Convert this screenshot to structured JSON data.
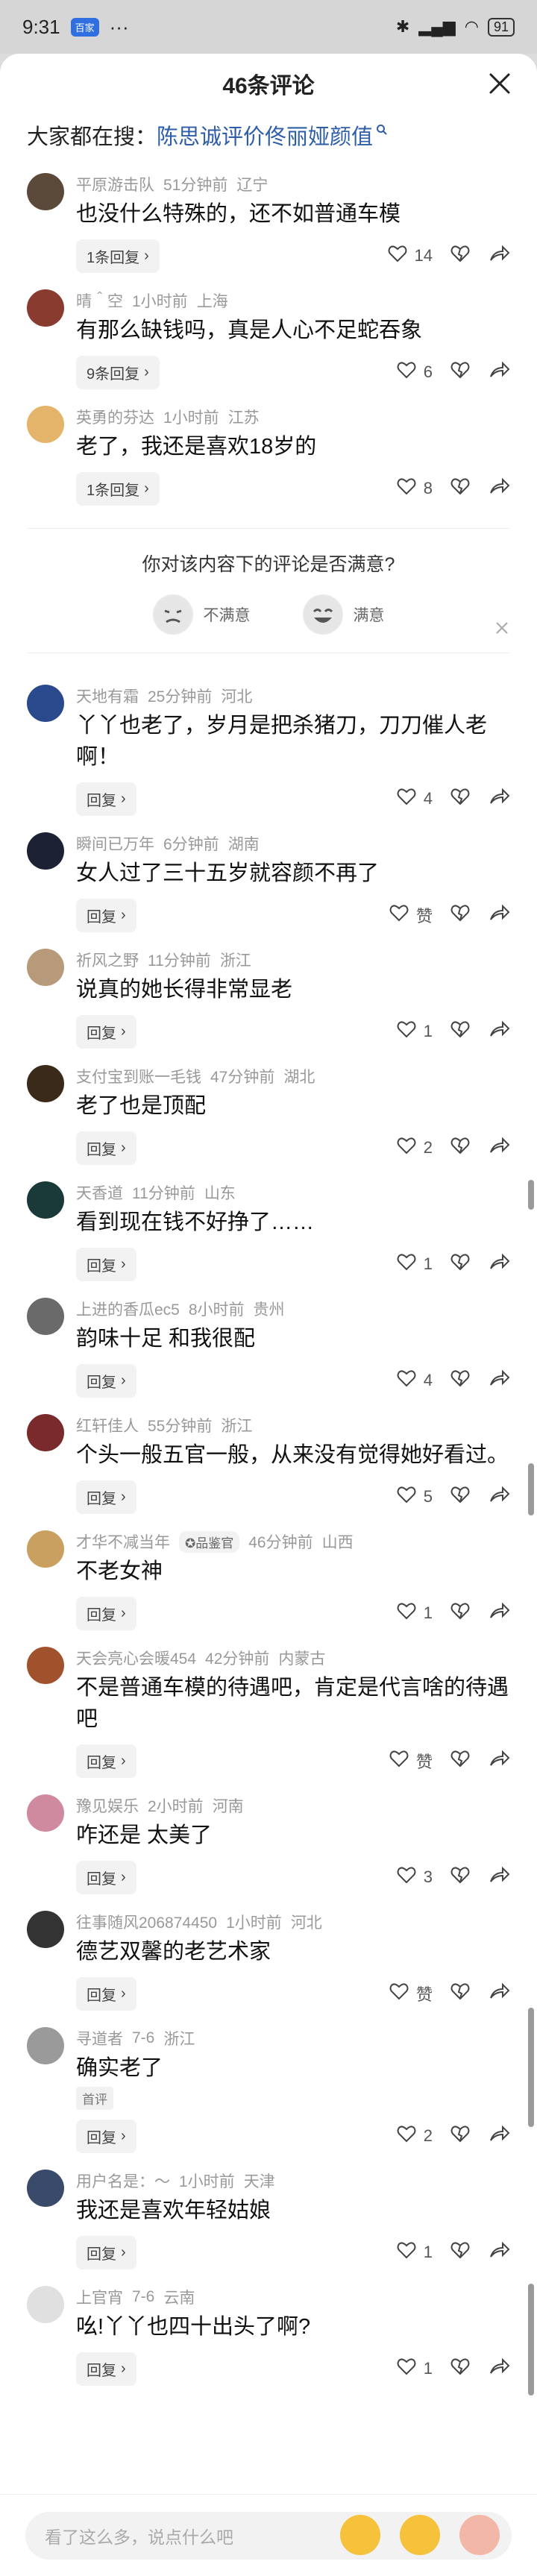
{
  "status": {
    "time": "9:31",
    "app_badge": "百家",
    "dots": "···",
    "battery": "91"
  },
  "header": {
    "title": "46条评论"
  },
  "search": {
    "prefix": "大家都在搜：",
    "query": "陈思诚评价佟丽娅颜值"
  },
  "survey": {
    "question": "你对该内容下的评论是否满意?",
    "opt_bad": "不满意",
    "opt_good": "满意"
  },
  "input": {
    "placeholder": "看了这么多，说点什么吧"
  },
  "comments": [
    {
      "user": "平原游击队",
      "time": "51分钟前",
      "loc": "辽宁",
      "text": "也没什么特殊的，还不如普通车模",
      "reply": "1条回复",
      "like": "14"
    },
    {
      "user": "晴＾空",
      "time": "1小时前",
      "loc": "上海",
      "text": "有那么缺钱吗，真是人心不足蛇吞象",
      "reply": "9条回复",
      "like": "6"
    },
    {
      "user": "英勇的芬达",
      "time": "1小时前",
      "loc": "江苏",
      "text": "老了，我还是喜欢18岁的",
      "reply": "1条回复",
      "like": "8"
    },
    {
      "user": "天地有霜",
      "time": "25分钟前",
      "loc": "河北",
      "text": "丫丫也老了，岁月是把杀猪刀，刀刀催人老啊！",
      "reply": "回复",
      "like": "4"
    },
    {
      "user": "瞬间已万年",
      "time": "6分钟前",
      "loc": "湖南",
      "text": "女人过了三十五岁就容颜不再了",
      "reply": "回复",
      "like": "赞"
    },
    {
      "user": "祈风之野",
      "time": "11分钟前",
      "loc": "浙江",
      "text": "说真的她长得非常显老",
      "reply": "回复",
      "like": "1"
    },
    {
      "user": "支付宝到账一毛钱",
      "time": "47分钟前",
      "loc": "湖北",
      "text": "老了也是顶配",
      "reply": "回复",
      "like": "2"
    },
    {
      "user": "天香道",
      "time": "11分钟前",
      "loc": "山东",
      "text": "看到现在钱不好挣了……",
      "reply": "回复",
      "like": "1"
    },
    {
      "user": "上进的香瓜ec5",
      "time": "8小时前",
      "loc": "贵州",
      "text": "韵味十足 和我很配",
      "reply": "回复",
      "like": "4"
    },
    {
      "user": "红轩佳人",
      "time": "55分钟前",
      "loc": "浙江",
      "text": "个头一般五官一般，从来没有觉得她好看过。",
      "reply": "回复",
      "like": "5"
    },
    {
      "user": "才华不减当年",
      "badge": "品鉴官",
      "time": "46分钟前",
      "loc": "山西",
      "text": "不老女神",
      "reply": "回复",
      "like": "1"
    },
    {
      "user": "天会亮心会暖454",
      "time": "42分钟前",
      "loc": "内蒙古",
      "text": "不是普通车模的待遇吧，肯定是代言啥的待遇吧",
      "reply": "回复",
      "like": "赞"
    },
    {
      "user": "豫见娱乐",
      "time": "2小时前",
      "loc": "河南",
      "text": "咋还是 太美了",
      "reply": "回复",
      "like": "3"
    },
    {
      "user": "往事随风206874450",
      "time": "1小时前",
      "loc": "河北",
      "text": "德艺双馨的老艺术家",
      "reply": "回复",
      "like": "赞"
    },
    {
      "user": "寻道者",
      "time": "7-6",
      "loc": "浙江",
      "text": "确实老了",
      "tag": "首评",
      "reply": "回复",
      "like": "2"
    },
    {
      "user": "用户名是：～",
      "time": "1小时前",
      "loc": "天津",
      "text": "我还是喜欢年轻姑娘",
      "reply": "回复",
      "like": "1"
    },
    {
      "user": "上官宵",
      "time": "7-6",
      "loc": "云南",
      "text": "吆!丫丫也四十出头了啊?",
      "reply": "回复",
      "like": "1"
    }
  ],
  "colors": {
    "link": "#2f5ea8",
    "meta": "#999999",
    "sheet": "#ffffff",
    "backdrop": "#dcdcdc"
  }
}
